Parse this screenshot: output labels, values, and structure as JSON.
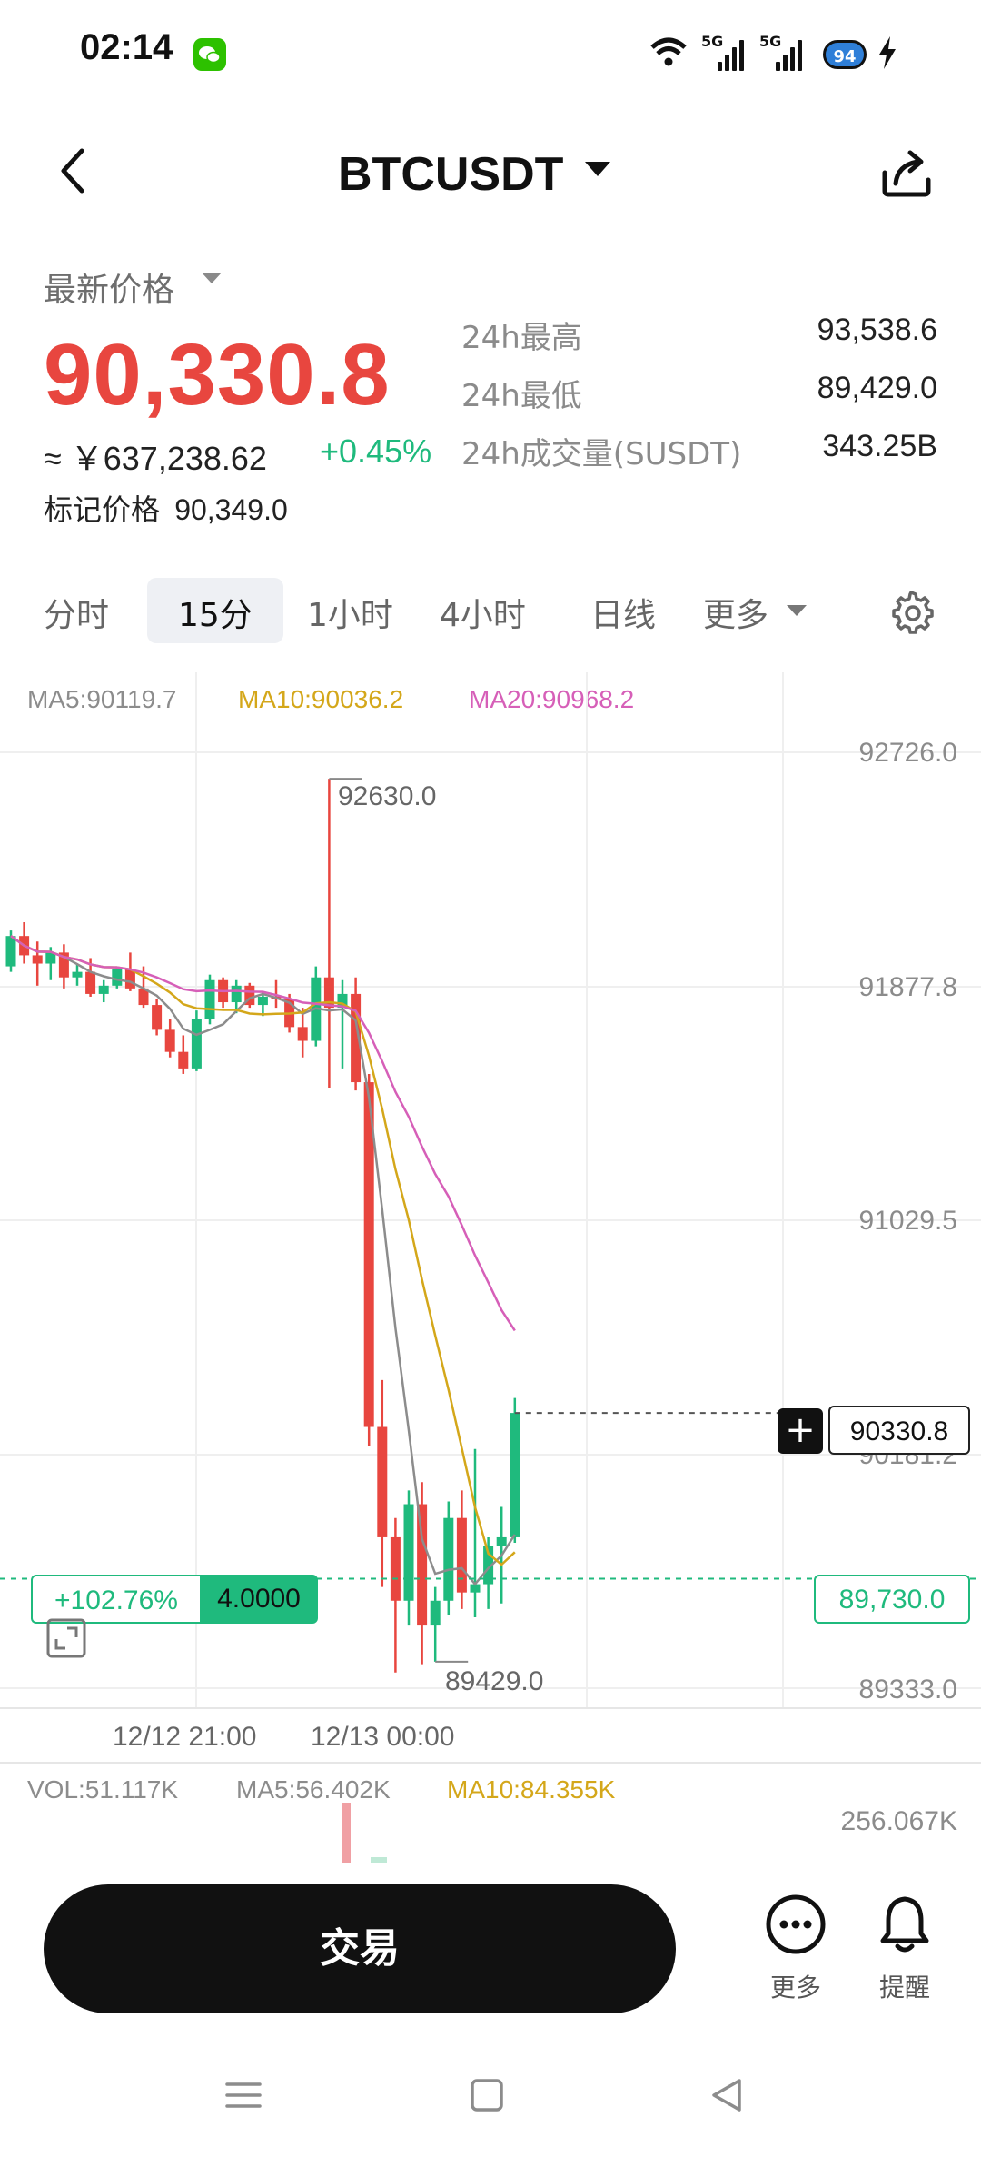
{
  "status_bar": {
    "time": "02:14",
    "network_1": "5G",
    "network_2": "5G",
    "battery": "94"
  },
  "header": {
    "title": "BTCUSDT"
  },
  "price": {
    "label": "最新价格",
    "last": "90,330.8",
    "cny": "≈ ￥637,238.62",
    "change": "+0.45%",
    "mark_label": "标记价格",
    "mark_value": "90,349.0"
  },
  "stats": [
    {
      "label": "24h最高",
      "value": "93,538.6"
    },
    {
      "label": "24h最低",
      "value": "89,429.0"
    },
    {
      "label": "24h成交量(SUSDT)",
      "value": "343.25B"
    }
  ],
  "intervals": {
    "tabs": [
      "分时",
      "15分",
      "1小时",
      "4小时",
      "日线",
      "更多"
    ],
    "selected": "15分"
  },
  "chart": {
    "ma5": "MA5:90119.7",
    "ma10": "MA10:90036.2",
    "ma20": "MA20:90968.2",
    "y_ticks": [
      "92726.0",
      "91877.8",
      "91029.5",
      "90181.2",
      "89333.0"
    ],
    "x_ticks": [
      "12/12 21:00",
      "12/13 00:00"
    ],
    "high_annotation": "92630.0",
    "low_annotation": "89429.0",
    "current_price": "90330.8",
    "position_pnl": "+102.76%",
    "position_qty": "4.0000",
    "entry_price": "89,730.0",
    "colors": {
      "up": "#1fba7d",
      "down": "#e8463f",
      "ma5": "#8c8c8c",
      "ma10": "#d4a71a",
      "ma20": "#d65fb8"
    }
  },
  "volume": {
    "vol": "VOL:51.117K",
    "ma5": "MA5:56.402K",
    "ma10": "MA10:84.355K",
    "max": "256.067K"
  },
  "bottom": {
    "trade_label": "交易",
    "more_label": "更多",
    "alert_label": "提醒"
  },
  "chart_data": {
    "type": "candlestick",
    "x_labels": [
      "12/12 21:00",
      "12/13 00:00"
    ],
    "ylim": [
      89333.0,
      92726.0
    ],
    "grid": true,
    "candles": [
      [
        91950,
        92080,
        91930,
        92060
      ],
      [
        92060,
        92110,
        91960,
        91990
      ],
      [
        91990,
        92040,
        91880,
        91960
      ],
      [
        91960,
        92020,
        91900,
        92000
      ],
      [
        92000,
        92030,
        91870,
        91910
      ],
      [
        91910,
        91960,
        91880,
        91930
      ],
      [
        91930,
        91980,
        91840,
        91850
      ],
      [
        91850,
        91900,
        91820,
        91880
      ],
      [
        91880,
        91950,
        91870,
        91940
      ],
      [
        91940,
        92000,
        91860,
        91870
      ],
      [
        91870,
        91950,
        91800,
        91810
      ],
      [
        91810,
        91830,
        91700,
        91720
      ],
      [
        91720,
        91760,
        91620,
        91640
      ],
      [
        91640,
        91700,
        91560,
        91580
      ],
      [
        91580,
        91790,
        91570,
        91760
      ],
      [
        91760,
        91920,
        91740,
        91900
      ],
      [
        91900,
        91910,
        91800,
        91820
      ],
      [
        91820,
        91900,
        91780,
        91880
      ],
      [
        91880,
        91890,
        91800,
        91810
      ],
      [
        91810,
        91860,
        91770,
        91840
      ],
      [
        91840,
        91900,
        91800,
        91830
      ],
      [
        91830,
        91850,
        91710,
        91730
      ],
      [
        91730,
        91800,
        91620,
        91680
      ],
      [
        91680,
        91950,
        91660,
        91910
      ],
      [
        91910,
        92630,
        91510,
        91800
      ],
      [
        91800,
        91900,
        91580,
        91850
      ],
      [
        91850,
        91910,
        91500,
        91530
      ],
      [
        91530,
        91560,
        90210,
        90280
      ],
      [
        90280,
        90450,
        89700,
        89880
      ],
      [
        89880,
        89950,
        89390,
        89650
      ],
      [
        89650,
        90050,
        89560,
        90000
      ],
      [
        90000,
        90080,
        89420,
        89560
      ],
      [
        89560,
        89700,
        89429,
        89650
      ],
      [
        89650,
        90010,
        89600,
        89950
      ],
      [
        89950,
        90050,
        89620,
        89680
      ],
      [
        89680,
        90200,
        89590,
        89710
      ],
      [
        89710,
        89880,
        89620,
        89850
      ],
      [
        89850,
        89990,
        89640,
        89880
      ],
      [
        89880,
        90385,
        89860,
        90330.8
      ]
    ],
    "ma5": "MA5:90119.7",
    "ma10": "MA10:90036.2",
    "ma20": "MA20:90968.2"
  }
}
